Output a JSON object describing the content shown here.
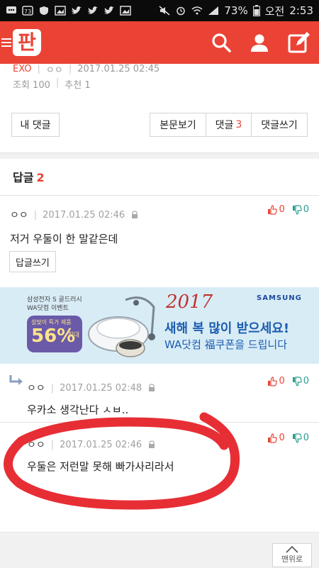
{
  "status_bar": {
    "battery": "73%",
    "time_label": "오전",
    "time": "2:53"
  },
  "header": {
    "logo": "판",
    "accent": "#ea4335",
    "icons": [
      "menu-icon",
      "search-icon",
      "user-icon",
      "edit-icon"
    ]
  },
  "post": {
    "category": "EXO",
    "author": "ㅇㅇ",
    "datetime": "2017.01.25 02:45",
    "views": "조회 100",
    "recommend": "추천 1"
  },
  "toolbar": {
    "my_comments": "내 댓글",
    "view_post": "본문보기",
    "comments_label": "댓글",
    "comments_count": "3",
    "write_comment": "댓글쓰기"
  },
  "replies": {
    "title": "답글",
    "count": "2"
  },
  "comments": [
    {
      "author": "ㅇㅇ",
      "datetime": "2017.01.25 02:46",
      "up": "0",
      "down": "0",
      "text": "저거 우둘이 한 말같은데",
      "reply_button": "답글쓰기"
    },
    {
      "author": "ㅇㅇ",
      "datetime": "2017.01.25 02:48",
      "up": "0",
      "down": "0",
      "text": "우카소 생각난다 ㅅㅂ.."
    },
    {
      "author": "ㅇㅇ",
      "datetime": "2017.01.25 02:46",
      "up": "0",
      "down": "0",
      "text": "우둘은 저런말 못해 빠가사리라서"
    }
  ],
  "ad": {
    "sponsor_line1": "삼성전자 S 골드러시",
    "sponsor_line2": "WA닷컴 이벤트",
    "promo_small": "설맞이 특가 제품",
    "percent": "56%",
    "max_label": "최대",
    "year": "2017",
    "brand": "SAMSUNG",
    "headline": "새해 복 많이 받으세요!",
    "subline": "WA닷컴 福쿠폰을 드립니다"
  },
  "top_button": {
    "label": "맨위로"
  }
}
